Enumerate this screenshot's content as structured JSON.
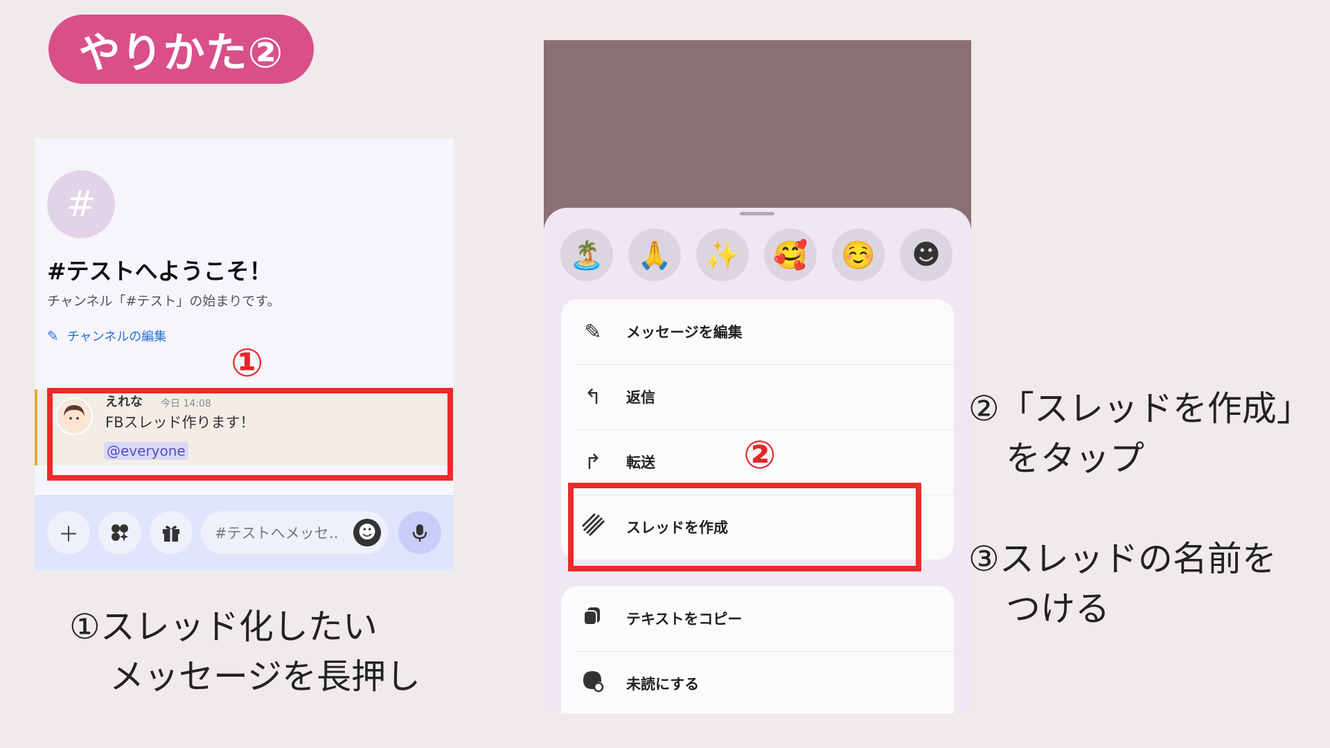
{
  "title": "やりかた②",
  "left_screen": {
    "channel_avatar": "#",
    "welcome_title": "#テストへようこそ！",
    "welcome_subtitle": "チャンネル「#テスト」の始まりです。",
    "edit_channel": "チャンネルの編集",
    "message": {
      "author": "えれな",
      "time": "今日 14:08",
      "text": "FBスレッド作ります！",
      "mention": "@everyone"
    },
    "input_placeholder": "#テストへメッセ‥"
  },
  "step1_marker": "①",
  "step2_marker": "②",
  "right_screen": {
    "reactions": [
      "🏝️",
      "🙏",
      "✨",
      "🥰",
      "☺️",
      "☻"
    ],
    "menu_group1": [
      {
        "icon": "pencil-icon",
        "label": "メッセージを編集"
      },
      {
        "icon": "reply-icon",
        "label": "返信"
      },
      {
        "icon": "forward-icon",
        "label": "転送"
      },
      {
        "icon": "thread-icon",
        "label": "スレッドを作成"
      }
    ],
    "menu_group2": [
      {
        "icon": "copy-icon",
        "label": "テキストをコピー"
      },
      {
        "icon": "unread-icon",
        "label": "未読にする"
      }
    ]
  },
  "instructions": {
    "step1_line1": "①スレッド化したい",
    "step1_line2": "メッセージを長押し",
    "step2_line1": "②「スレッドを作成」",
    "step2_line2": "をタップ",
    "step3_line1": "③スレッドの名前を",
    "step3_line2": "つける"
  },
  "colors": {
    "title_pill": "#d94f8a",
    "highlight": "#ee2a2a",
    "background": "#efebea"
  }
}
